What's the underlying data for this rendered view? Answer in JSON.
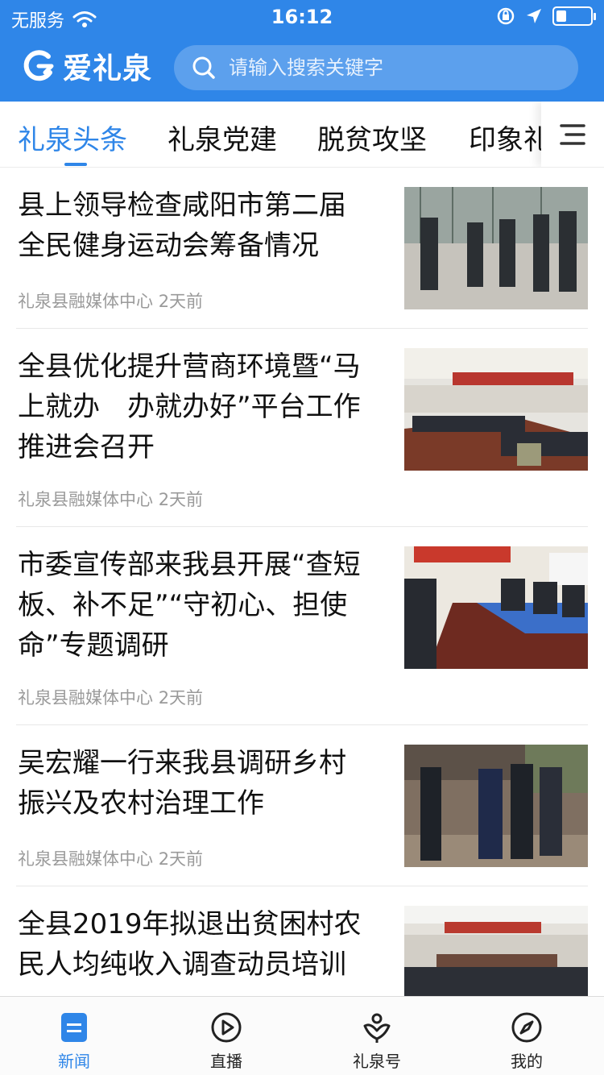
{
  "status_bar": {
    "carrier": "无服务",
    "time": "16:12",
    "battery_level": 0.3
  },
  "header": {
    "app_name": "爱礼泉",
    "search_placeholder": "请输入搜索关键字",
    "brand_color": "#2f86e8"
  },
  "tabs": [
    {
      "label": "礼泉头条",
      "active": true
    },
    {
      "label": "礼泉党建",
      "active": false
    },
    {
      "label": "脱贫攻坚",
      "active": false
    },
    {
      "label": "印象礼泉",
      "active": false
    }
  ],
  "news": [
    {
      "title_lines": [
        "县上领导检查咸阳市第二届",
        "全民健身运动会筹备情况"
      ],
      "source": "礼泉县融媒体中心",
      "time": "2天前"
    },
    {
      "title_lines": [
        "全县优化提升营商环境暨“马",
        "上就办　办就办好”平台工作",
        "推进会召开"
      ],
      "source": "礼泉县融媒体中心",
      "time": "2天前"
    },
    {
      "title_lines": [
        "市委宣传部来我县开展“查短",
        "板、补不足”“守初心、担使",
        "命”专题调研"
      ],
      "source": "礼泉县融媒体中心",
      "time": "2天前"
    },
    {
      "title_lines": [
        "吴宏耀一行来我县调研乡村",
        "振兴及农村治理工作"
      ],
      "source": "礼泉县融媒体中心",
      "time": "2天前"
    },
    {
      "title_lines": [
        "全县2019年拟退出贫困村农",
        "民人均纯收入调查动员培训"
      ],
      "source": "",
      "time": ""
    }
  ],
  "bottom_tabs": [
    {
      "label": "新闻",
      "icon": "news-icon",
      "active": true
    },
    {
      "label": "直播",
      "icon": "play-icon",
      "active": false
    },
    {
      "label": "礼泉号",
      "icon": "heart-person-icon",
      "active": false
    },
    {
      "label": "我的",
      "icon": "compass-icon",
      "active": false
    }
  ]
}
